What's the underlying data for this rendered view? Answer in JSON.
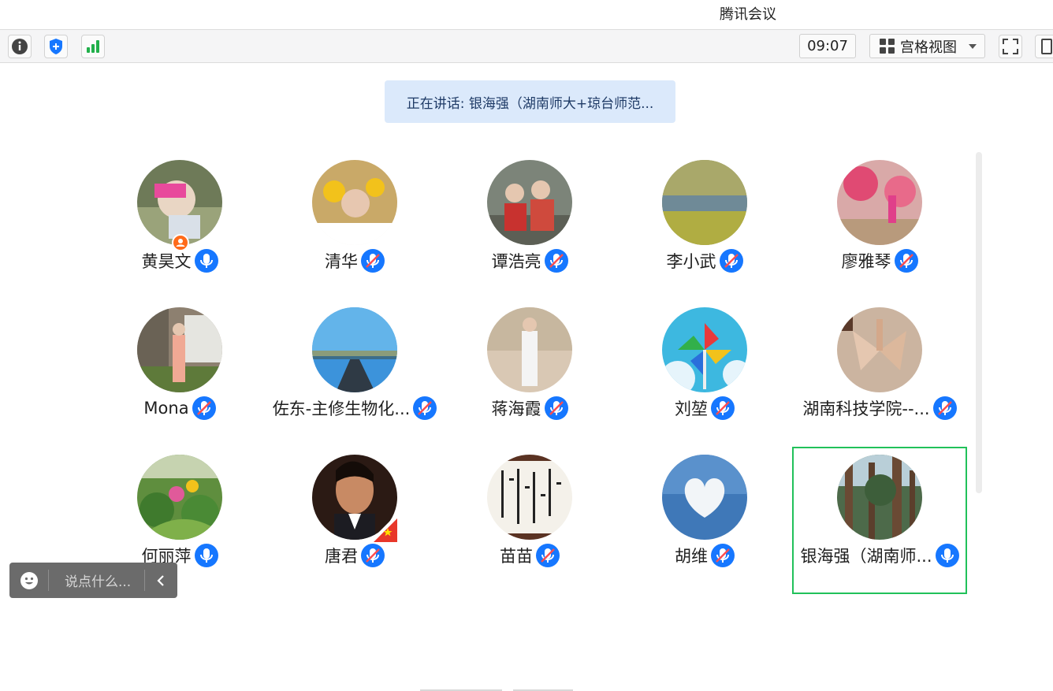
{
  "app": {
    "title": "腾讯会议"
  },
  "toolbar": {
    "time": "09:07",
    "view_mode": "宫格视图",
    "icons": [
      "info-icon",
      "shield-icon",
      "signal-icon",
      "fullscreen-icon",
      "window-icon"
    ]
  },
  "speaking": {
    "label": "正在讲话: 银海强（湖南师大+琼台师范..."
  },
  "participants": [
    {
      "name": "黄昊文",
      "mic": "on"
    },
    {
      "name": "清华",
      "mic": "muted"
    },
    {
      "name": "谭浩亮",
      "mic": "muted"
    },
    {
      "name": "李小武",
      "mic": "muted"
    },
    {
      "name": "廖雅琴",
      "mic": "muted"
    },
    {
      "name": "Mona",
      "mic": "muted"
    },
    {
      "name": "佐东-主修生物化...",
      "mic": "muted"
    },
    {
      "name": "蒋海霞",
      "mic": "muted"
    },
    {
      "name": "刘堃",
      "mic": "muted"
    },
    {
      "name": "湖南科技学院--...",
      "mic": "muted"
    },
    {
      "name": "何丽萍",
      "mic": "on"
    },
    {
      "name": "唐君",
      "mic": "muted"
    },
    {
      "name": "苗苗",
      "mic": "muted"
    },
    {
      "name": "胡维",
      "mic": "muted"
    },
    {
      "name": "银海强（湖南师...",
      "mic": "on",
      "active": true
    }
  ],
  "chat": {
    "placeholder": "说点什么..."
  },
  "colors": {
    "accent": "#1677ff",
    "active_border": "#21c15a",
    "host_badge": "#ff6b1a"
  }
}
